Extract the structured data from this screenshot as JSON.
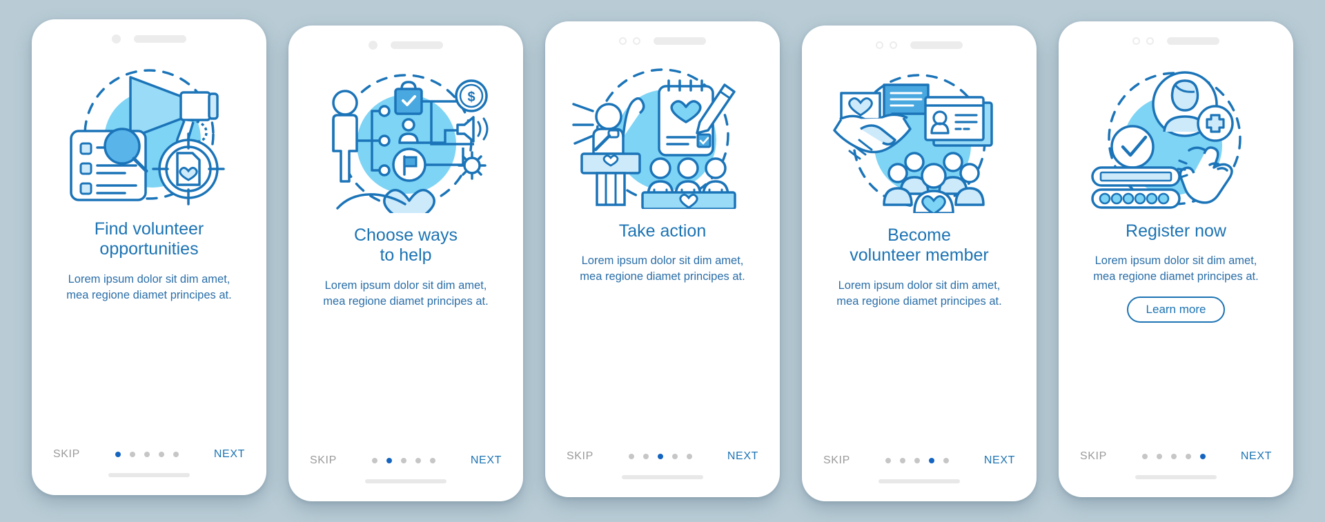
{
  "theme": {
    "background": "#b9ccd6",
    "card_background": "#ffffff",
    "title_color": "#1c73b3",
    "body_color": "#2a6ea8",
    "accent_blue": "#1565c0",
    "stroke_blue": "#1b74b8",
    "fill_light_blue": "#cdeafb",
    "circle_blue": "#7ed4f5",
    "inactive_dot": "#c6c6c6",
    "skip_color": "#9a9a9a"
  },
  "common": {
    "skip_label": "SKIP",
    "next_label": "NEXT",
    "body_text": "Lorem ipsum dolor sit dim amet, mea regione diamet principes at.",
    "total_steps": 5
  },
  "screens": [
    {
      "id": "find-volunteer-opportunities",
      "title": "Find volunteer\nopportunities",
      "body": "Lorem ipsum dolor sit dim amet, mea regione diamet principes at.",
      "skip_label": "SKIP",
      "next_label": "NEXT",
      "active_step": 1,
      "notch_style": "dot-bar",
      "illustration": "megaphone-checklist-search-target",
      "has_learn_more": false,
      "learn_more_label": ""
    },
    {
      "id": "choose-ways-to-help",
      "title": "Choose ways\nto help",
      "body": "Lorem ipsum dolor sit dim amet, mea regione diamet principes at.",
      "skip_label": "SKIP",
      "next_label": "NEXT",
      "active_step": 2,
      "notch_style": "dot-bar",
      "illustration": "person-options-hand-heart",
      "has_learn_more": false,
      "learn_more_label": ""
    },
    {
      "id": "take-action",
      "title": "Take action",
      "body": "Lorem ipsum dolor sit dim amet, mea regione diamet principes at.",
      "skip_label": "SKIP",
      "next_label": "NEXT",
      "active_step": 3,
      "notch_style": "two-rings-bar",
      "illustration": "speaker-podium-audience-notepad",
      "has_learn_more": false,
      "learn_more_label": ""
    },
    {
      "id": "become-volunteer-member",
      "title": "Become\nvolunteer member",
      "body": "Lorem ipsum dolor sit dim amet, mea regione diamet principes at.",
      "skip_label": "SKIP",
      "next_label": "NEXT",
      "active_step": 4,
      "notch_style": "two-rings-bar",
      "illustration": "handshake-idcard-group",
      "has_learn_more": false,
      "learn_more_label": ""
    },
    {
      "id": "register-now",
      "title": "Register now",
      "body": "Lorem ipsum dolor sit dim amet, mea regione diamet principes at.",
      "skip_label": "SKIP",
      "next_label": "NEXT",
      "active_step": 5,
      "notch_style": "two-rings-bar",
      "illustration": "avatar-plus-check-form-hand",
      "has_learn_more": true,
      "learn_more_label": "Learn more"
    }
  ]
}
